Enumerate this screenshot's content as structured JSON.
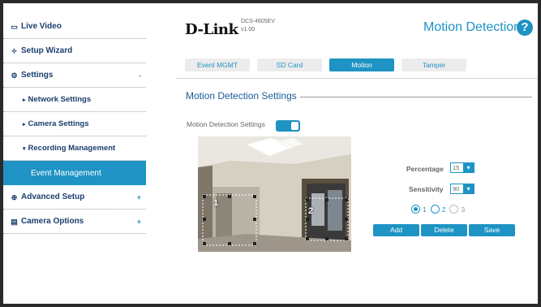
{
  "sidebar": {
    "items": [
      {
        "label": "Live Video",
        "icon": "video-icon"
      },
      {
        "label": "Setup Wizard",
        "icon": "wand-icon"
      },
      {
        "label": "Settings",
        "icon": "gear-icon",
        "toggle": "-"
      },
      {
        "label": "Network Settings"
      },
      {
        "label": "Camera Settings"
      },
      {
        "label": "Recording Management"
      },
      {
        "label": "Event Management"
      },
      {
        "label": "Advanced Setup",
        "icon": "advanced-icon",
        "toggle": "+"
      },
      {
        "label": "Camera Options",
        "icon": "camera-options-icon",
        "toggle": "+"
      }
    ]
  },
  "header": {
    "logo": "D-Link",
    "model": "DCS-4605EV",
    "version": "v1.00",
    "title": "Motion Detection",
    "help": "?"
  },
  "tabs": [
    "Event MGMT",
    "SD Card",
    "Motion",
    "Tamper"
  ],
  "section": {
    "title": "Motion Detection Settings",
    "toggle_label": "Motion Detection Settings"
  },
  "camera": {
    "region_1": "1",
    "region_2": "2"
  },
  "controls": {
    "percentage_label": "Percentage",
    "percentage_value": "15",
    "sensitivity_label": "Sensitivity",
    "sensitivity_value": "90",
    "regions": [
      "1",
      "2",
      "3"
    ],
    "add": "Add",
    "delete": "Delete",
    "save": "Save"
  },
  "colors": {
    "accent": "#1e93c4",
    "nav_text": "#1a3e6e"
  }
}
